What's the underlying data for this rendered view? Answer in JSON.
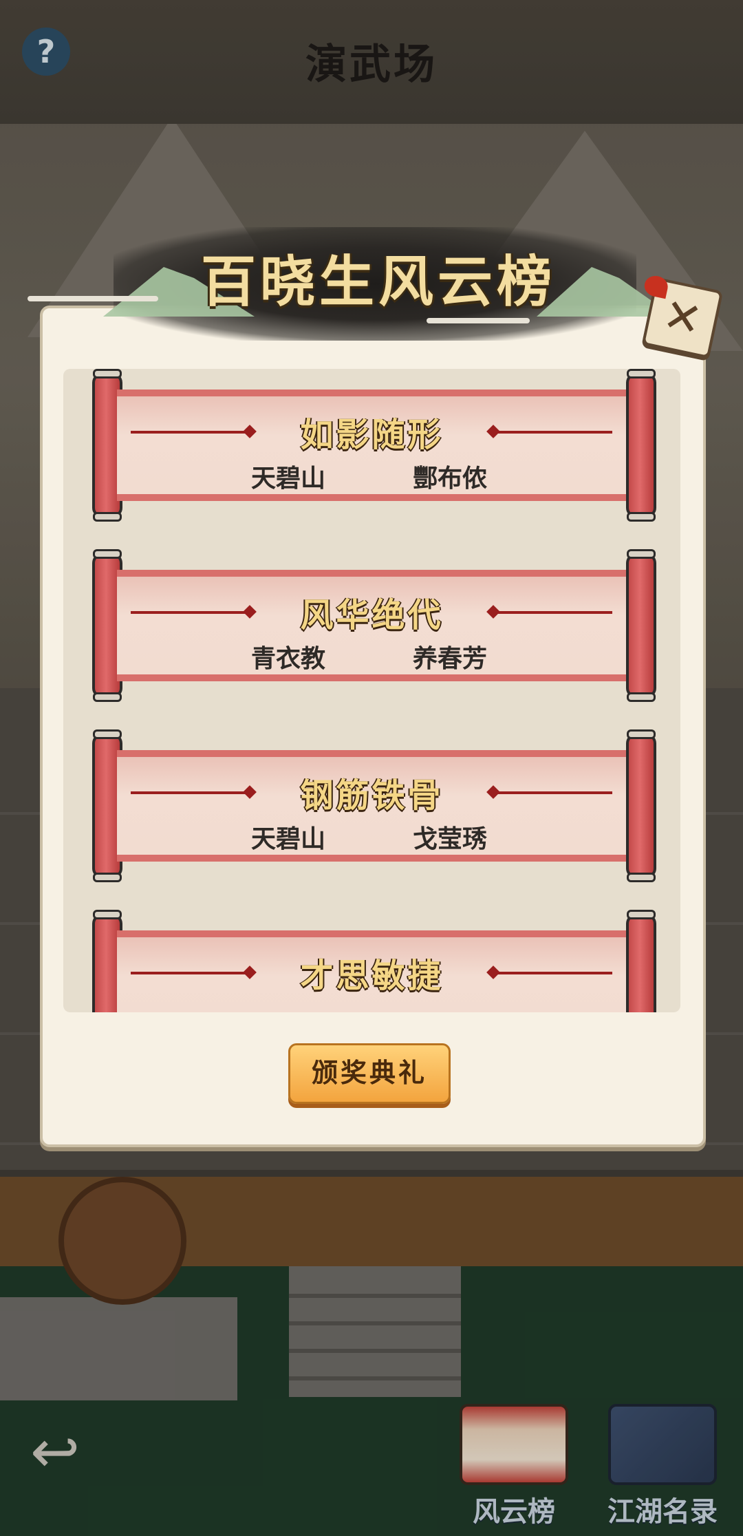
{
  "scene": {
    "title": "演武场",
    "help_label": "?",
    "back_label": "↩",
    "nav": [
      {
        "label": "风云榜",
        "icon": "scroll-board-icon"
      },
      {
        "label": "江湖名录",
        "icon": "book-icon"
      }
    ]
  },
  "panel": {
    "title": "百晓生风云榜",
    "close_label": "✕",
    "award_button": "颁奖典礼"
  },
  "scrolls": [
    {
      "title": "如影随形",
      "left": "天碧山",
      "right": "酆布侬"
    },
    {
      "title": "风华绝代",
      "left": "青衣教",
      "right": "养春芳"
    },
    {
      "title": "钢筋铁骨",
      "left": "天碧山",
      "right": "戈莹琇"
    },
    {
      "title": "才思敏捷",
      "left": "",
      "right": ""
    }
  ],
  "colors": {
    "accent": "#f3a43e",
    "title_gold": "#f3dda0",
    "scroll_red": "#d86f6b",
    "panel_bg": "#f7f1e4"
  }
}
